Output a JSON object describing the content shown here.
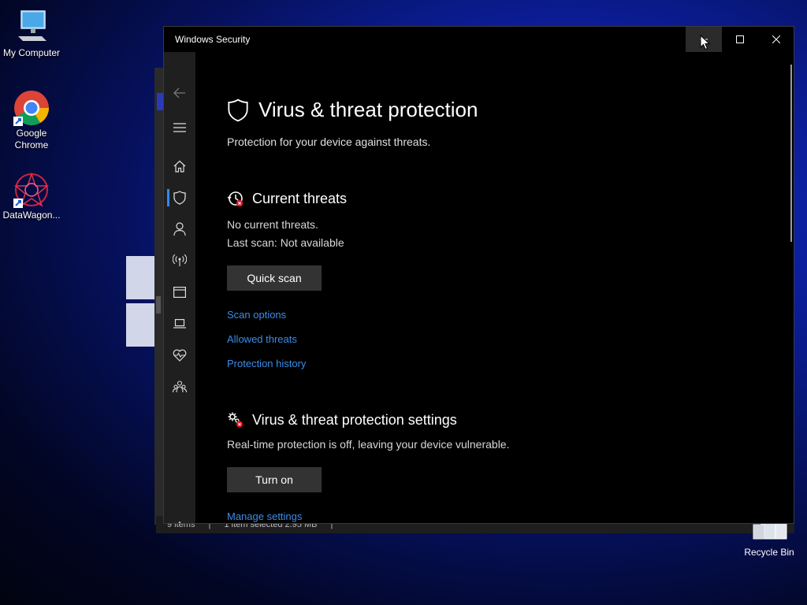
{
  "desktop": {
    "icons": [
      {
        "label": "My Computer",
        "icon": "computer-icon"
      },
      {
        "label": "Google Chrome",
        "icon": "chrome-icon"
      },
      {
        "label": "DataWagon...",
        "icon": "datawagon-icon"
      }
    ],
    "recycle_bin": {
      "label": "Recycle Bin",
      "icon": "recycle-bin-icon"
    },
    "explorer_status": {
      "items": "9 items",
      "selected": "1 item selected  2.95 MB"
    }
  },
  "window": {
    "title": "Windows Security",
    "controls": [
      "minimize",
      "maximize",
      "close"
    ]
  },
  "nav": {
    "items": [
      {
        "name": "back",
        "icon": "back-arrow-icon"
      },
      {
        "name": "menu",
        "icon": "hamburger-icon"
      },
      {
        "name": "home",
        "icon": "home-icon"
      },
      {
        "name": "virus-threat",
        "icon": "shield-icon",
        "active": true
      },
      {
        "name": "account",
        "icon": "person-icon"
      },
      {
        "name": "firewall",
        "icon": "antenna-icon"
      },
      {
        "name": "app-browser",
        "icon": "window-icon"
      },
      {
        "name": "device-security",
        "icon": "laptop-icon"
      },
      {
        "name": "device-health",
        "icon": "heart-icon"
      },
      {
        "name": "family",
        "icon": "family-icon"
      },
      {
        "name": "settings",
        "icon": "gear-icon"
      }
    ],
    "accent": "#2d8cf0"
  },
  "page": {
    "title": "Virus & threat protection",
    "subtitle": "Protection for your device against threats.",
    "current_threats": {
      "heading": "Current threats",
      "status": "No current threats.",
      "last_scan": "Last scan: Not available",
      "button": "Quick scan",
      "links": [
        "Scan options",
        "Allowed threats",
        "Protection history"
      ]
    },
    "settings": {
      "heading": "Virus & threat protection settings",
      "description": "Real-time protection is off, leaving your device vulnerable.",
      "button": "Turn on",
      "link": "Manage settings"
    },
    "link_color": "#3b8de8"
  }
}
